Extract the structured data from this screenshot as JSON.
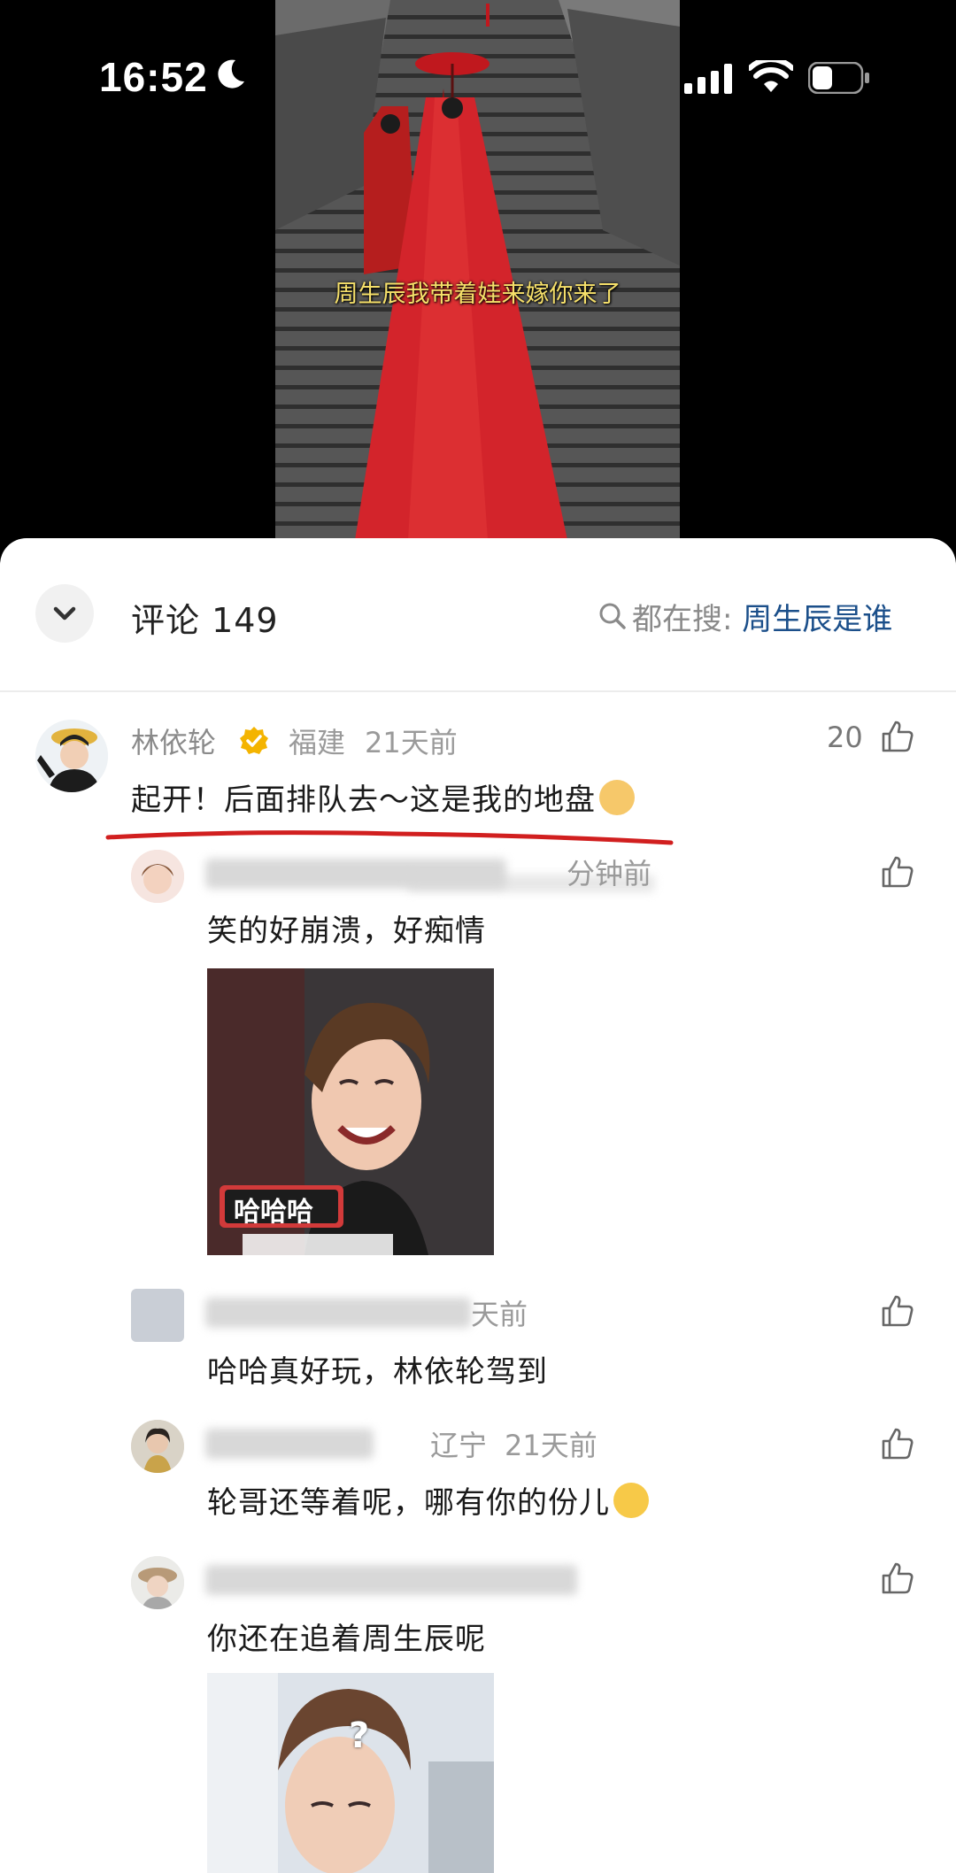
{
  "status_bar": {
    "time": "16:52"
  },
  "video": {
    "caption": "周生辰我带着娃来嫁你来了"
  },
  "comments_header": {
    "title": "评论 149",
    "search_prefix": "都在搜:",
    "search_query": "周生辰是谁"
  },
  "comments": [
    {
      "author": "林依轮",
      "verified": true,
      "location": "福建",
      "time": "21天前",
      "likes": "20",
      "text": "起开！后面排队去～这是我的地盘",
      "replies": [
        {
          "time": "分钟前",
          "text": "笑的好崩溃，好痴情",
          "image_label": "哈哈哈"
        },
        {
          "time": "天前",
          "text": "哈哈真好玩，林依轮驾到"
        },
        {
          "location": "辽宁",
          "time": "21天前",
          "text": "轮哥还等着呢，哪有你的份儿"
        },
        {
          "text": "你还在追着周生辰呢",
          "image_label": "?"
        }
      ]
    }
  ],
  "colors": {
    "accent_link": "#1b4f8a",
    "underline": "#d11f1f",
    "verified_badge": "#f4b400"
  }
}
